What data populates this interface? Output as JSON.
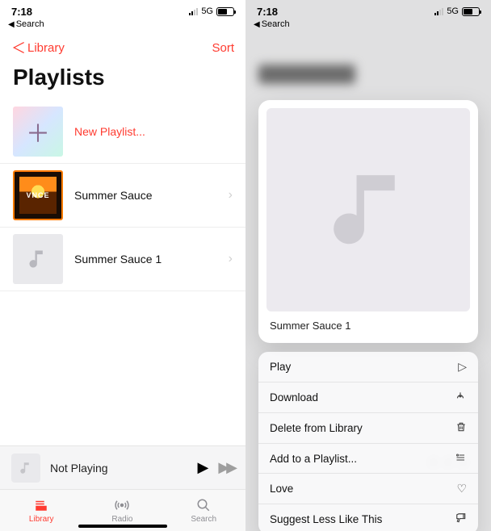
{
  "status": {
    "time": "7:18",
    "net": "5G"
  },
  "breadcrumb": "Search",
  "left": {
    "back": "Library",
    "sort": "Sort",
    "title": "Playlists",
    "rows": {
      "new": "New Playlist...",
      "p1": "Summer Sauce",
      "p1_art_text": "VNCE",
      "p2": "Summer Sauce 1"
    },
    "nowplaying": "Not Playing",
    "tabs": {
      "library": "Library",
      "radio": "Radio",
      "search": "Search"
    }
  },
  "right": {
    "preview_title": "Summer Sauce 1",
    "menu": {
      "play": "Play",
      "download": "Download",
      "delete": "Delete from Library",
      "add": "Add to a Playlist...",
      "love": "Love",
      "suggest": "Suggest Less Like This"
    }
  }
}
